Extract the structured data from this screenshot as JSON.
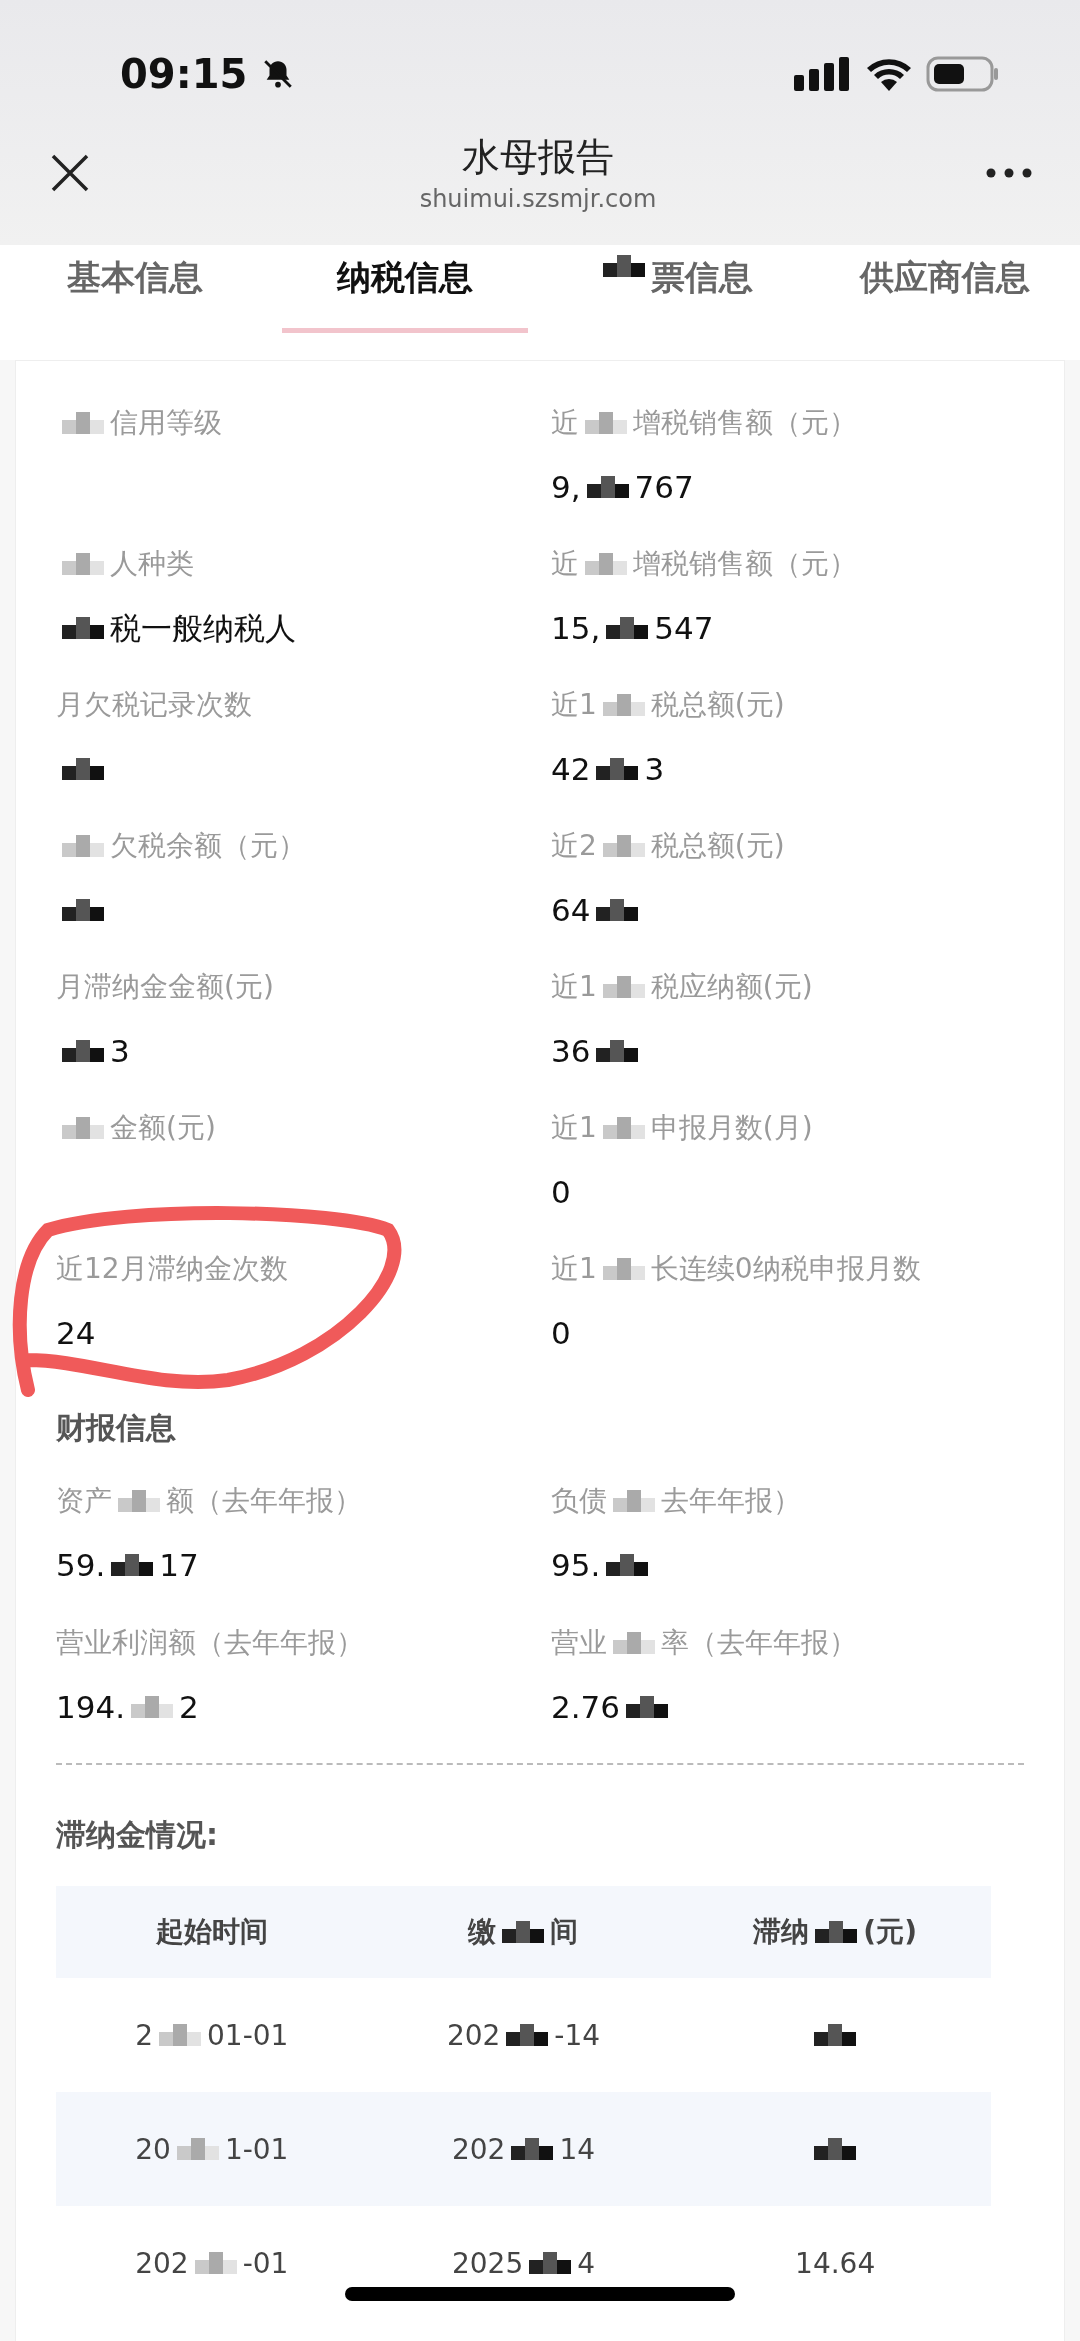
{
  "status_bar": {
    "time": "09:15"
  },
  "nav": {
    "title": "水母报告",
    "url": "shuimui.szsmjr.com"
  },
  "tabs": [
    {
      "parts": [
        {
          "kind": "text",
          "text": "基本信息"
        }
      ],
      "selected": false
    },
    {
      "parts": [
        {
          "kind": "text",
          "text": "纳税信息"
        }
      ],
      "selected": true
    },
    {
      "parts": [
        {
          "kind": "mosaic",
          "dark": true
        },
        {
          "kind": "text",
          "text": "票信息"
        }
      ],
      "selected": false
    },
    {
      "parts": [
        {
          "kind": "text",
          "text": "供应商信息"
        }
      ],
      "selected": false
    }
  ],
  "tax_fields": [
    {
      "label": [
        {
          "kind": "mosaic",
          "dark": false
        },
        {
          "kind": "text",
          "text": "信用等级"
        }
      ]
    },
    {
      "label": [
        {
          "kind": "text",
          "text": "近"
        },
        {
          "kind": "mosaic",
          "dark": false
        },
        {
          "kind": "text",
          "text": "增税销售额（元）"
        }
      ],
      "value": [
        {
          "kind": "text",
          "text": "9,"
        },
        {
          "kind": "mosaic",
          "dark": true
        },
        {
          "kind": "text",
          "text": "767"
        }
      ]
    },
    {
      "label": [
        {
          "kind": "mosaic",
          "dark": false
        },
        {
          "kind": "text",
          "text": "人种类"
        }
      ],
      "value": [
        {
          "kind": "mosaic",
          "dark": true
        },
        {
          "kind": "text",
          "text": "税一般纳税人"
        }
      ]
    },
    {
      "label": [
        {
          "kind": "text",
          "text": "近"
        },
        {
          "kind": "mosaic",
          "dark": false
        },
        {
          "kind": "text",
          "text": "增税销售额（元）"
        }
      ],
      "value": [
        {
          "kind": "text",
          "text": "15,"
        },
        {
          "kind": "mosaic",
          "dark": true
        },
        {
          "kind": "text",
          "text": "547"
        }
      ]
    },
    {
      "label": [
        {
          "kind": "text",
          "text": "月欠税记录次数"
        }
      ],
      "value": [
        {
          "kind": "mosaic",
          "dark": true
        }
      ]
    },
    {
      "label": [
        {
          "kind": "text",
          "text": "近1"
        },
        {
          "kind": "mosaic",
          "dark": false
        },
        {
          "kind": "text",
          "text": "税总额(元)"
        }
      ],
      "value": [
        {
          "kind": "text",
          "text": "42"
        },
        {
          "kind": "mosaic",
          "dark": true
        },
        {
          "kind": "text",
          "text": "3"
        }
      ]
    },
    {
      "label": [
        {
          "kind": "mosaic",
          "dark": false
        },
        {
          "kind": "text",
          "text": "欠税余额（元）"
        }
      ],
      "value": [
        {
          "kind": "mosaic",
          "dark": true
        }
      ]
    },
    {
      "label": [
        {
          "kind": "text",
          "text": "近2"
        },
        {
          "kind": "mosaic",
          "dark": false
        },
        {
          "kind": "text",
          "text": "税总额(元)"
        }
      ],
      "value": [
        {
          "kind": "text",
          "text": "64"
        },
        {
          "kind": "mosaic",
          "dark": true
        }
      ]
    },
    {
      "label": [
        {
          "kind": "text",
          "text": "月滞纳金金额(元)"
        }
      ],
      "value": [
        {
          "kind": "mosaic",
          "dark": true
        },
        {
          "kind": "text",
          "text": "3"
        }
      ]
    },
    {
      "label": [
        {
          "kind": "text",
          "text": "近1"
        },
        {
          "kind": "mosaic",
          "dark": false
        },
        {
          "kind": "text",
          "text": "税应纳额(元)"
        }
      ],
      "value": [
        {
          "kind": "text",
          "text": "36"
        },
        {
          "kind": "mosaic",
          "dark": true
        }
      ]
    },
    {
      "label": [
        {
          "kind": "mosaic",
          "dark": false
        },
        {
          "kind": "text",
          "text": "金额(元)"
        }
      ]
    },
    {
      "label": [
        {
          "kind": "text",
          "text": "近1"
        },
        {
          "kind": "mosaic",
          "dark": false
        },
        {
          "kind": "text",
          "text": "申报月数(月)"
        }
      ],
      "value": [
        {
          "kind": "text",
          "text": "0"
        }
      ]
    },
    {
      "label": [
        {
          "kind": "text",
          "text": "近12月滞纳金次数"
        }
      ],
      "value": [
        {
          "kind": "text",
          "text": "24"
        }
      ]
    },
    {
      "label": [
        {
          "kind": "text",
          "text": "近1"
        },
        {
          "kind": "mosaic",
          "dark": false
        },
        {
          "kind": "text",
          "text": "长连续0纳税申报月数"
        }
      ],
      "value": [
        {
          "kind": "text",
          "text": "0"
        }
      ]
    }
  ],
  "annotation": {
    "kind": "ellipse",
    "color": "#f05a5a"
  },
  "finance": {
    "heading": "财报信息",
    "fields": [
      {
        "label": [
          {
            "kind": "text",
            "text": "资产"
          },
          {
            "kind": "mosaic",
            "dark": false
          },
          {
            "kind": "text",
            "text": "额（去年年报）"
          }
        ],
        "value": [
          {
            "kind": "text",
            "text": "59."
          },
          {
            "kind": "mosaic",
            "dark": true
          },
          {
            "kind": "text",
            "text": "17"
          }
        ]
      },
      {
        "label": [
          {
            "kind": "text",
            "text": "负债"
          },
          {
            "kind": "mosaic",
            "dark": false
          },
          {
            "kind": "text",
            "text": "去年年报）"
          }
        ],
        "value": [
          {
            "kind": "text",
            "text": "95."
          },
          {
            "kind": "mosaic",
            "dark": true
          }
        ]
      },
      {
        "label": [
          {
            "kind": "text",
            "text": "营业利润额（去年年报）"
          }
        ],
        "value": [
          {
            "kind": "text",
            "text": "194."
          },
          {
            "kind": "mosaic",
            "dark": false
          },
          {
            "kind": "text",
            "text": "2"
          }
        ]
      },
      {
        "label": [
          {
            "kind": "text",
            "text": "营业"
          },
          {
            "kind": "mosaic",
            "dark": false
          },
          {
            "kind": "text",
            "text": "率（去年年报）"
          }
        ],
        "value": [
          {
            "kind": "text",
            "text": "2.76"
          },
          {
            "kind": "mosaic",
            "dark": true
          }
        ]
      }
    ]
  },
  "late_fees": {
    "heading": "滞纳金情况:",
    "header": {
      "cells": [
        {
          "parts": [
            {
              "kind": "text",
              "text": "起始时间"
            }
          ]
        },
        {
          "parts": [
            {
              "kind": "text",
              "text": "缴"
            },
            {
              "kind": "mosaic",
              "dark": true
            },
            {
              "kind": "text",
              "text": "间"
            }
          ]
        },
        {
          "parts": [
            {
              "kind": "text",
              "text": "滞纳"
            },
            {
              "kind": "mosaic",
              "dark": true
            },
            {
              "kind": "text",
              "text": "(元)"
            }
          ]
        }
      ]
    },
    "records": [
      {
        "cells": [
          {
            "parts": [
              {
                "kind": "text",
                "text": "2"
              },
              {
                "kind": "mosaic",
                "dark": false
              },
              {
                "kind": "text",
                "text": "01-01"
              }
            ]
          },
          {
            "parts": [
              {
                "kind": "text",
                "text": "202"
              },
              {
                "kind": "mosaic",
                "dark": true
              },
              {
                "kind": "text",
                "text": "-14"
              }
            ]
          },
          {
            "parts": [
              {
                "kind": "mosaic",
                "dark": true
              }
            ]
          }
        ]
      },
      {
        "cells": [
          {
            "parts": [
              {
                "kind": "text",
                "text": "20"
              },
              {
                "kind": "mosaic",
                "dark": false
              },
              {
                "kind": "text",
                "text": "1-01"
              }
            ]
          },
          {
            "parts": [
              {
                "kind": "text",
                "text": "202"
              },
              {
                "kind": "mosaic",
                "dark": true
              },
              {
                "kind": "text",
                "text": "14"
              }
            ]
          },
          {
            "parts": [
              {
                "kind": "mosaic",
                "dark": true
              }
            ]
          }
        ]
      },
      {
        "cells": [
          {
            "parts": [
              {
                "kind": "text",
                "text": "202"
              },
              {
                "kind": "mosaic",
                "dark": false
              },
              {
                "kind": "text",
                "text": "-01"
              }
            ]
          },
          {
            "parts": [
              {
                "kind": "text",
                "text": "2025"
              },
              {
                "kind": "mosaic",
                "dark": true
              },
              {
                "kind": "text",
                "text": "4"
              }
            ]
          },
          {
            "parts": [
              {
                "kind": "text",
                "text": "14.64"
              }
            ]
          }
        ]
      }
    ]
  }
}
